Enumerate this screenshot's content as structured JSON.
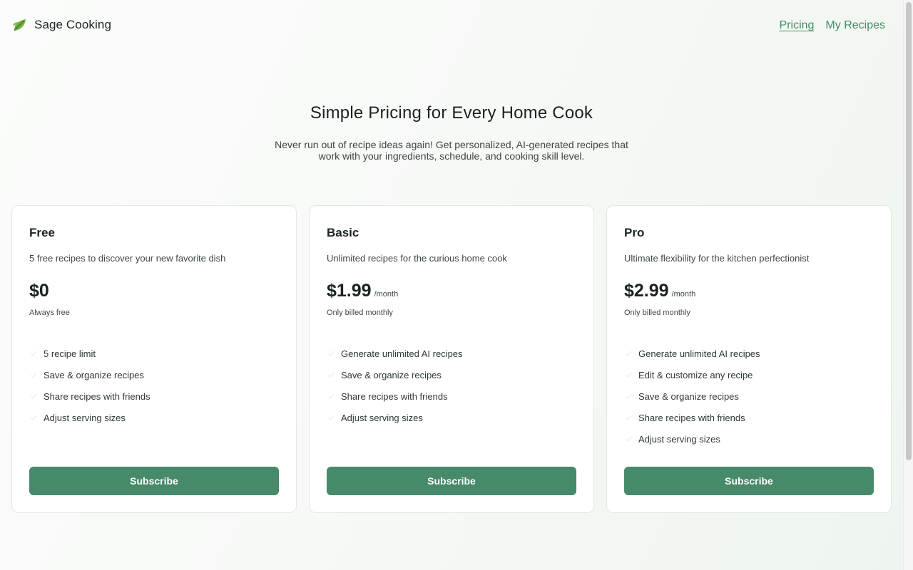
{
  "header": {
    "brand": "Sage Cooking",
    "brand_icon": "leaf-icon",
    "nav": [
      {
        "label": "Pricing",
        "active": true
      },
      {
        "label": "My Recipes",
        "active": false
      }
    ]
  },
  "hero": {
    "title": "Simple Pricing for Every Home Cook",
    "subtitle": "Never run out of recipe ideas again! Get personalized, AI-generated recipes that work with your ingredients, schedule, and cooking skill level."
  },
  "plans": [
    {
      "name": "Free",
      "description": "5 free recipes to discover your new favorite dish",
      "price": "$0",
      "period": "",
      "billing": "Always free",
      "features": [
        "5 recipe limit",
        "Save & organize recipes",
        "Share recipes with friends",
        "Adjust serving sizes"
      ],
      "cta": "Subscribe"
    },
    {
      "name": "Basic",
      "description": "Unlimited recipes for the curious home cook",
      "price": "$1.99",
      "period": "/month",
      "billing": "Only billed monthly",
      "features": [
        "Generate unlimited AI recipes",
        "Save & organize recipes",
        "Share recipes with friends",
        "Adjust serving sizes"
      ],
      "cta": "Subscribe"
    },
    {
      "name": "Pro",
      "description": "Ultimate flexibility for the kitchen perfectionist",
      "price": "$2.99",
      "period": "/month",
      "billing": "Only billed monthly",
      "features": [
        "Generate unlimited AI recipes",
        "Edit & customize any recipe",
        "Save & organize recipes",
        "Share recipes with friends",
        "Adjust serving sizes"
      ],
      "cta": "Subscribe"
    }
  ],
  "colors": {
    "accent": "#478a6a",
    "nav_link": "#478a68"
  }
}
